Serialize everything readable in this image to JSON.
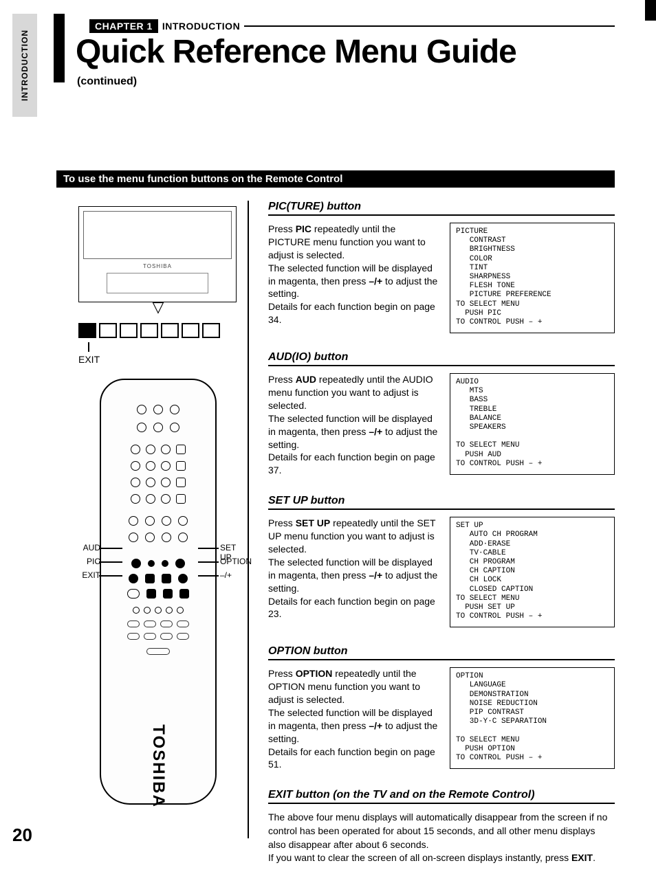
{
  "sideTab": "INTRODUCTION",
  "chapterBox": "CHAPTER 1",
  "chapterLabel": "INTRODUCTION",
  "title": "Quick Reference Menu Guide",
  "continued": "(continued)",
  "blackHeading": "To use the menu function buttons on the Remote Control",
  "tvBrand": "TOSHIBA",
  "exitLabel": "EXIT",
  "remoteBrand": "TOSHIBA",
  "remoteLabels": {
    "aud": "AUD",
    "pic": "PIC",
    "exit": "EXIT",
    "setup": "SET UP",
    "option": "OPTION",
    "pm": "–/+"
  },
  "sections": {
    "pic": {
      "heading": "PIC(TURE) button",
      "p1a": "Press ",
      "p1b": "PIC",
      "p1c": " repeatedly until the PICTURE menu function you want to adjust is selected.",
      "p2a": "The selected function will be displayed in magenta, then press ",
      "p2b": "–/+",
      "p2c": " to adjust the setting.",
      "p3": "Details for each function begin on page 34.",
      "osd": "PICTURE\n   CONTRAST\n   BRIGHTNESS\n   COLOR\n   TINT\n   SHARPNESS\n   FLESH TONE\n   PICTURE PREFERENCE\nTO SELECT MENU\n  PUSH PIC\nTO CONTROL PUSH – +"
    },
    "aud": {
      "heading": "AUD(IO) button",
      "p1a": "Press ",
      "p1b": "AUD",
      "p1c": " repeatedly until the AUDIO menu function you want to adjust is selected.",
      "p2a": "The selected function will be displayed in magenta, then press ",
      "p2b": "–/+",
      "p2c": " to adjust the setting.",
      "p3": "Details for each function begin on page 37.",
      "osd": "AUDIO\n   MTS\n   BASS\n   TREBLE\n   BALANCE\n   SPEAKERS\n\nTO SELECT MENU\n  PUSH AUD\nTO CONTROL PUSH – +"
    },
    "setup": {
      "heading": "SET UP button",
      "p1a": "Press ",
      "p1b": "SET UP",
      "p1c": " repeatedly until the SET UP menu function you want to adjust is selected.",
      "p2a": "The selected function will be displayed in magenta, then press ",
      "p2b": "–/+",
      "p2c": " to adjust the setting.",
      "p3": "Details for each function begin on page 23.",
      "osd": "SET UP\n   AUTO CH PROGRAM\n   ADD·ERASE\n   TV·CABLE\n   CH PROGRAM\n   CH CAPTION\n   CH LOCK\n   CLOSED CAPTION\nTO SELECT MENU\n  PUSH SET UP\nTO CONTROL PUSH – +"
    },
    "option": {
      "heading": "OPTION button",
      "p1a": "Press ",
      "p1b": "OPTION",
      "p1c": " repeatedly until the OPTION menu function you want to adjust is selected.",
      "p2a": "The selected function will be displayed in magenta, then press ",
      "p2b": "–/+",
      "p2c": " to adjust the setting.",
      "p3": "Details for each function begin on page 51.",
      "osd": "OPTION\n   LANGUAGE\n   DEMONSTRATION\n   NOISE REDUCTION\n   PIP CONTRAST\n   3D-Y·C SEPARATION\n\nTO SELECT MENU\n  PUSH OPTION\nTO CONTROL PUSH – +"
    },
    "exit": {
      "heading": "EXIT button (on the TV and on the Remote Control)",
      "p1": "The above four menu displays will automatically disappear from the screen if no control has been operated for about 15 seconds, and all other menu displays also disappear after about 6 seconds.",
      "p2a": "If you want to clear the screen of all on-screen displays instantly, press ",
      "p2b": "EXIT",
      "p2c": "."
    }
  },
  "pageNumber": "20"
}
